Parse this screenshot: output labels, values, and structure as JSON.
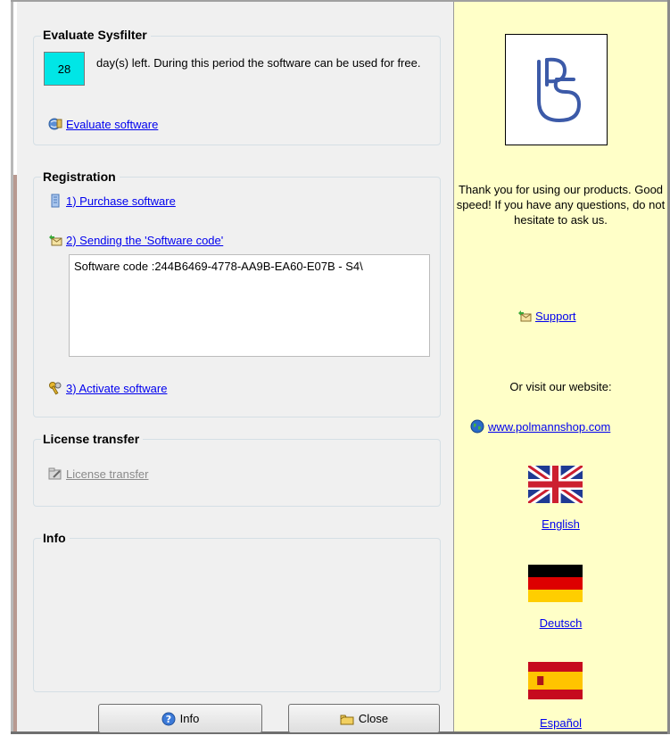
{
  "evaluate": {
    "title": "Evaluate Sysfilter",
    "days_left": "28",
    "days_text": "day(s) left. During this period the software can be used for free.",
    "evaluate_link": "Evaluate software"
  },
  "registration": {
    "title": "Registration",
    "purchase_link": "1) Purchase software",
    "sending_link": "2) Sending the 'Software code'",
    "software_code": "Software code :244B6469-4778-AA9B-EA60-E07B - S4\\",
    "activate_link": "3) Activate software"
  },
  "license": {
    "title": "License transfer",
    "transfer_link": "License transfer"
  },
  "info": {
    "title": "Info"
  },
  "buttons": {
    "info_label": "Info",
    "close_label": "Close"
  },
  "sidebar": {
    "thanks_text": "Thank you for using our products. Good speed! If you have any questions, do not hesitate to ask us.",
    "support_link": "Support",
    "visit_text": "Or visit our website:",
    "website_link": "www.polmannshop.com",
    "languages": [
      "English",
      "Deutsch",
      "Español"
    ]
  },
  "colors": {
    "days_box": "#00e6e6",
    "sidebar_bg": "#ffffc8",
    "panel_bg": "#f0f0f0",
    "link": "#0000ee"
  }
}
